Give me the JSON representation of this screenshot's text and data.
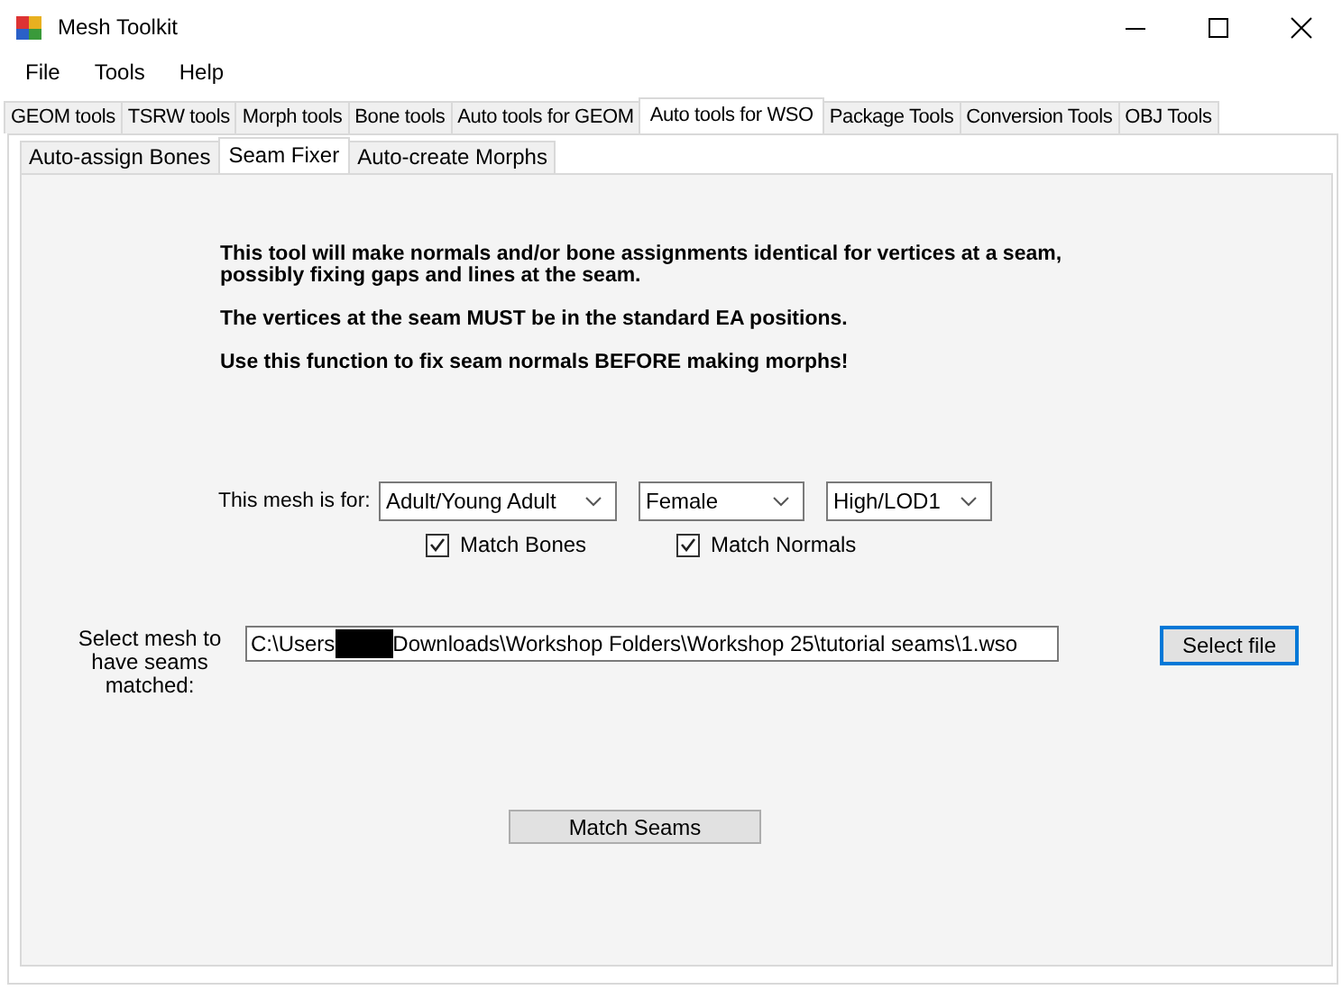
{
  "window": {
    "title": "Mesh Toolkit"
  },
  "menu": [
    "File",
    "Tools",
    "Help"
  ],
  "tabs": [
    {
      "label": "GEOM tools",
      "selected": false
    },
    {
      "label": "TSRW tools",
      "selected": false
    },
    {
      "label": "Morph tools",
      "selected": false
    },
    {
      "label": "Bone tools",
      "selected": false
    },
    {
      "label": "Auto tools for GEOM",
      "selected": false
    },
    {
      "label": "Auto tools for WSO",
      "selected": true
    },
    {
      "label": "Package Tools",
      "selected": false
    },
    {
      "label": "Conversion Tools",
      "selected": false
    },
    {
      "label": "OBJ Tools",
      "selected": false
    }
  ],
  "subtabs": [
    {
      "label": "Auto-assign Bones",
      "selected": false
    },
    {
      "label": "Seam Fixer",
      "selected": true
    },
    {
      "label": "Auto-create Morphs",
      "selected": false
    }
  ],
  "instructions": [
    "This tool will make normals and/or bone assignments identical for vertices at a seam, possibly fixing gaps and lines at the seam.",
    "The vertices at the seam MUST be in the standard EA positions.",
    "Use this function to fix seam normals BEFORE making morphs!"
  ],
  "mesh_for": {
    "label": "This mesh is for:",
    "dropdowns": [
      "Adult/Young Adult",
      "Female",
      "High/LOD1"
    ]
  },
  "checkboxes": [
    {
      "label": "Match Bones",
      "checked": true
    },
    {
      "label": "Match Normals",
      "checked": true
    }
  ],
  "file": {
    "label": "Select mesh to have seams matched:",
    "value_before": "C:\\Users",
    "redacted": true,
    "value_after": "Downloads\\Workshop Folders\\Workshop 25\\tutorial seams\\1.wso",
    "button": "Select file"
  },
  "action_button": "Match Seams"
}
